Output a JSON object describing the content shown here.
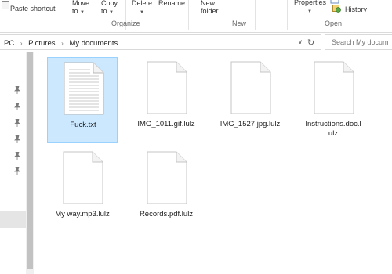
{
  "ribbon": {
    "paste_shortcut": "Paste shortcut",
    "move_to": "Move",
    "move_to_2": "to",
    "copy_to": "Copy",
    "copy_to_2": "to",
    "delete": "Delete",
    "rename": "Rename",
    "new_folder": "New",
    "new_folder_2": "folder",
    "properties": "Properties",
    "history": "History",
    "groups": {
      "organize": "Organize",
      "new": "New",
      "open": "Open"
    }
  },
  "address": {
    "crumbs": [
      "PC",
      "Pictures",
      "My documents"
    ]
  },
  "search": {
    "placeholder": "Search My docum"
  },
  "files": [
    {
      "name": "Fuck.txt",
      "type": "text",
      "selected": true
    },
    {
      "name": "IMG_1011.gif.lulz",
      "type": "blank",
      "selected": false
    },
    {
      "name": "IMG_1527.jpg.lulz",
      "type": "blank",
      "selected": false
    },
    {
      "name": "Instructions.doc.l",
      "name2": "ulz",
      "type": "blank",
      "selected": false
    },
    {
      "name": "My way.mp3.lulz",
      "type": "blank",
      "selected": false
    },
    {
      "name": "Records.pdf.lulz",
      "type": "blank",
      "selected": false
    }
  ],
  "colors": {
    "selection_fill": "#cce8ff",
    "selection_border": "#99d1ff"
  }
}
